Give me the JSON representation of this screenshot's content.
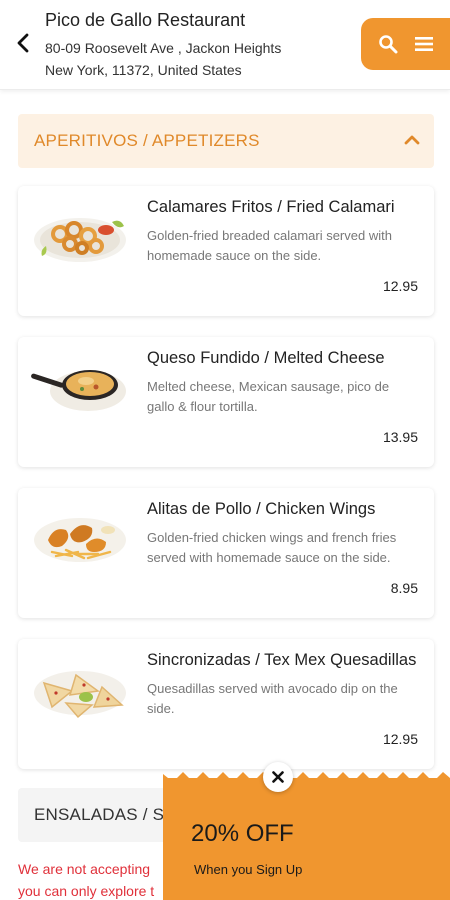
{
  "header": {
    "restaurant_name": "Pico de Gallo Restaurant",
    "address_line1": "80-09 Roosevelt Ave , Jackon Heights",
    "address_line2": "New York, 11372, United States",
    "back_icon": "chevron-left-icon",
    "search_icon": "search-icon",
    "menu_icon": "hamburger-menu-icon",
    "accent_color": "#f0962f"
  },
  "sections": {
    "appetizers": {
      "title": "APERITIVOS / APPETIZERS",
      "expanded": true,
      "toggle_icon": "chevron-up-icon"
    },
    "salads": {
      "title": "ENSALADAS / SA"
    }
  },
  "items": [
    {
      "name": "Calamares Fritos / Fried Calamari",
      "description": "Golden-fried breaded calamari served with homemade sauce on the side.",
      "price": "12.95"
    },
    {
      "name": "Queso Fundido / Melted Cheese",
      "description": "Melted cheese, Mexican sausage, pico de gallo & flour tortilla.",
      "price": "13.95"
    },
    {
      "name": "Alitas de Pollo / Chicken Wings",
      "description": "Golden-fried chicken wings and french fries served with homemade sauce on the side.",
      "price": "8.95"
    },
    {
      "name": "Sincronizadas / Tex Mex Quesadillas",
      "description": "Quesadillas served with avocado dip on the side.",
      "price": "12.95"
    }
  ],
  "notice": {
    "line1": "We are not accepting",
    "line2": "you can only explore t",
    "color": "#e0303a"
  },
  "promo": {
    "title": "20% OFF",
    "subtitle": "When you Sign Up",
    "close_icon": "close-icon"
  }
}
